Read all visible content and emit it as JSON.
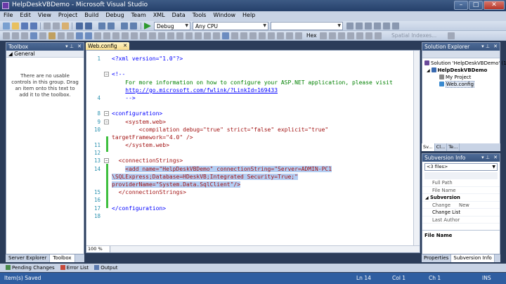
{
  "window": {
    "title": "HelpDeskVBDemo - Microsoft Visual Studio",
    "min": "–",
    "max": "□",
    "close": "✕"
  },
  "menu": [
    "File",
    "Edit",
    "View",
    "Project",
    "Build",
    "Debug",
    "Team",
    "XML",
    "Data",
    "Tools",
    "Window",
    "Help"
  ],
  "toolbar": {
    "configuration": "Debug",
    "platform": "Any CPU",
    "hex_label": "Hex",
    "spatial_label": "Spatial Indexes..."
  },
  "toolbox": {
    "title": "Toolbox",
    "group": "◢ General",
    "message": "There are no usable controls in this group. Drag an item onto this text to add it to the toolbox."
  },
  "left_tabs": [
    "Server Explorer",
    "Toolbox"
  ],
  "editor": {
    "tab": "Web.config",
    "zoom": "100 %",
    "lines": {
      "l1": "<?xml version=\"1.0\"?>",
      "l4a": "<!--",
      "l4b": "For more information on how to configure your ASP.NET application, please visit",
      "l4c": "http://go.microsoft.com/fwlink/?LinkId=169433",
      "l4d": "-->",
      "l8": "<configuration>",
      "l9": "<system.web>",
      "l10a": "<compilation debug=\"true\" strict=\"false\" explicit=\"true\"",
      "l10b": "targetFramework=\"4.0\" />",
      "l11": "</system.web>",
      "l13": "<connectionStrings>",
      "l14a": "<add name=\"HelpDeskVBDemo\" connectionString=\"Server=ADMIN-PC1",
      "l14b": "\\SQLExpress;Database=HDeskVB;Integrated Security=True;\"",
      "l14c": "providerName=\"System.Data.SqlClient\"/>",
      "l15": "</connectionStrings>",
      "l17": "</configuration>"
    },
    "line_numbers": [
      "1",
      "4",
      "8",
      "9",
      "10",
      "11",
      "12",
      "13",
      "14",
      "15",
      "16",
      "17",
      "18"
    ]
  },
  "solution_explorer": {
    "title": "Solution Explorer",
    "nodes": [
      "Solution 'HelpDeskVBDemo' (1 project)",
      "HelpDeskVBDemo",
      "My Project",
      "Web.config"
    ],
    "tabs": [
      "Sv...",
      "Cl...",
      "Te..."
    ]
  },
  "subversion": {
    "title": "Subversion Info",
    "combo": "<3 files>",
    "props": [
      {
        "name": "Full Path",
        "value": "",
        "kind": "prop"
      },
      {
        "name": "File Name",
        "value": "",
        "kind": "prop"
      },
      {
        "name": "Subversion",
        "value": "",
        "kind": "cat"
      },
      {
        "name": "Change",
        "value": "New",
        "kind": "prop"
      },
      {
        "name": "Change List",
        "value": "",
        "kind": "plain"
      },
      {
        "name": "Last Author",
        "value": "",
        "kind": "prop"
      }
    ],
    "desc_title": "File Name"
  },
  "right_tabs": [
    "Properties",
    "Subversion Info"
  ],
  "bottom_tabs": [
    "Pending Changes",
    "Error List",
    "Output"
  ],
  "status": {
    "text": "Item(s) Saved",
    "ln": "Ln 14",
    "col": "Col 1",
    "ch": "Ch 1",
    "mode": "INS"
  }
}
